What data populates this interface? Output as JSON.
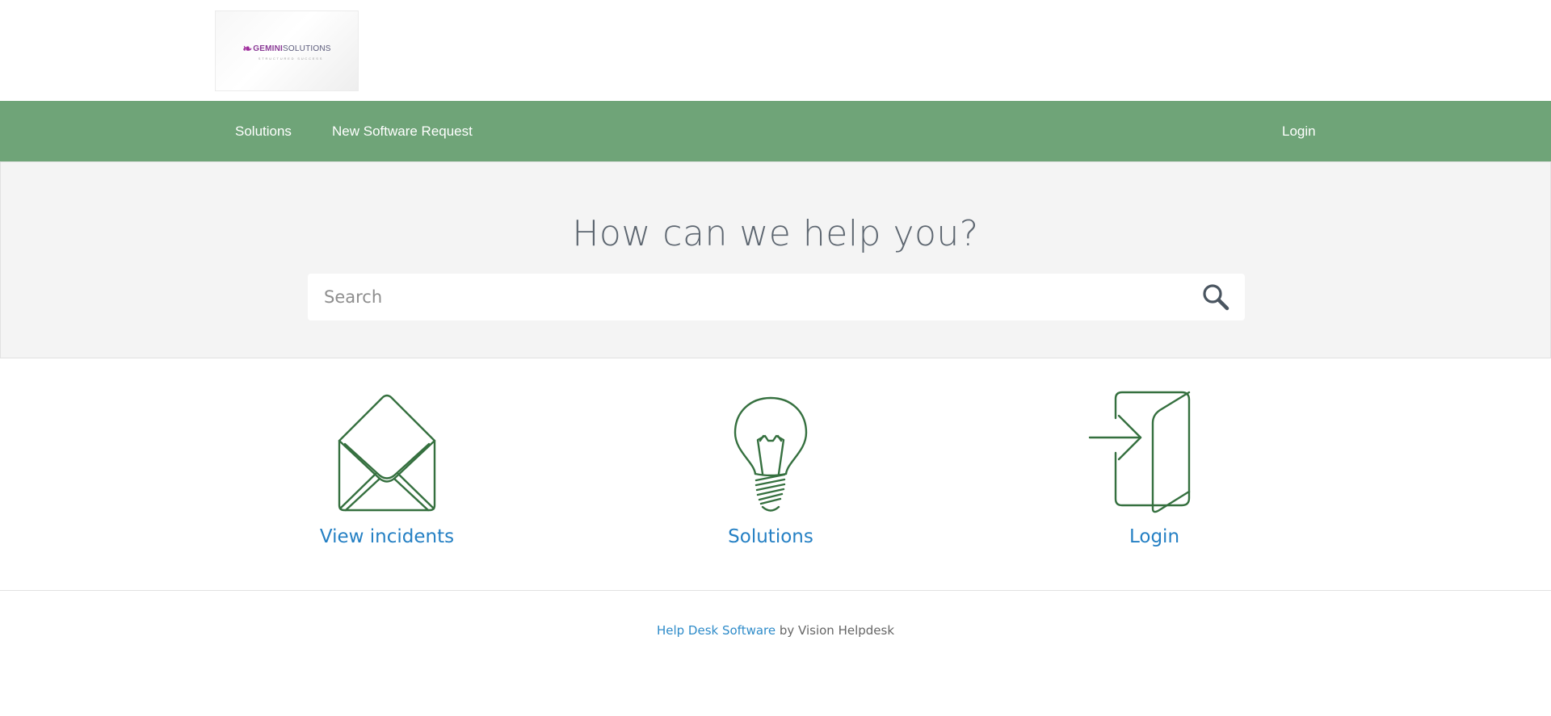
{
  "logo": {
    "brand_name": "GEMINI SOLUTIONS",
    "brand_first": "GEMINI",
    "brand_second": " SOLUTIONS",
    "tagline": "STRUCTURED SUCCESS"
  },
  "nav": {
    "left_items": [
      {
        "label": "Solutions"
      },
      {
        "label": "New Software Request"
      }
    ],
    "right_items": [
      {
        "label": "Login"
      }
    ],
    "background_color": "#6fa478"
  },
  "hero": {
    "title": "How can we help you?",
    "search": {
      "placeholder": "Search",
      "value": ""
    }
  },
  "features": [
    {
      "label": "View incidents",
      "icon": "envelope-open-icon"
    },
    {
      "label": "Solutions",
      "icon": "lightbulb-icon"
    },
    {
      "label": "Login",
      "icon": "login-door-icon"
    }
  ],
  "footer": {
    "link_text": "Help Desk Software",
    "suffix": " by Vision Helpdesk"
  },
  "colors": {
    "icon_stroke": "#35703f",
    "link": "#2580c4",
    "hero_background": "#f4f4f4"
  }
}
